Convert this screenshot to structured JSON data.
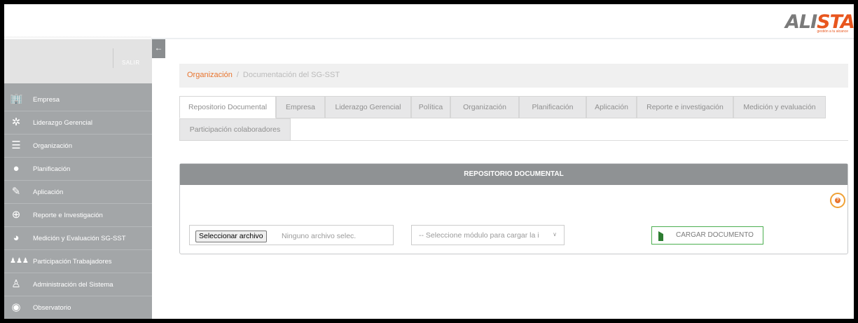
{
  "brand": {
    "logo_text_a": "ALI",
    "logo_text_b": "STA",
    "tagline": "gestión a tu alcance"
  },
  "sidebar": {
    "logout_label": "SALIR",
    "items": [
      {
        "label": "Empresa",
        "icon": "building-icon"
      },
      {
        "label": "Liderazgo Gerencial",
        "icon": "people-network-icon"
      },
      {
        "label": "Organización",
        "icon": "list-icon"
      },
      {
        "label": "Planificación",
        "icon": "head-gear-icon"
      },
      {
        "label": "Aplicación",
        "icon": "pencil-icon"
      },
      {
        "label": "Reporte e Investigación",
        "icon": "magnifier-icon"
      },
      {
        "label": "Medición y Evaluación SG-SST",
        "icon": "pie-chart-icon"
      },
      {
        "label": "Participación Trabajadores",
        "icon": "group-icon"
      },
      {
        "label": "Administración del Sistema",
        "icon": "user-admin-icon"
      },
      {
        "label": "Observatorio",
        "icon": "globe-icon"
      }
    ]
  },
  "breadcrumb": {
    "parent": "Organización",
    "separator": "/",
    "current": "Documentación del SG-SST"
  },
  "tabs": [
    "Repositorio Documental",
    "Empresa",
    "Liderazgo Gerencial",
    "Política",
    "Organización",
    "Planificación",
    "Aplicación",
    "Reporte e investigación",
    "Medición y evaluación",
    "Participación colaboradores"
  ],
  "panel": {
    "title": "REPOSITORIO DOCUMENTAL",
    "file_button": "Seleccionar archivo",
    "file_status": "Ninguno archivo selec.",
    "module_select": "-- Seleccione módulo para cargar la i",
    "upload_button": "CARGAR DOCUMENTO"
  },
  "colors": {
    "accent": "#e8742e",
    "sidebar": "#a3a6a8",
    "panel_header": "#8f9294",
    "upload_border": "#4caf50"
  }
}
